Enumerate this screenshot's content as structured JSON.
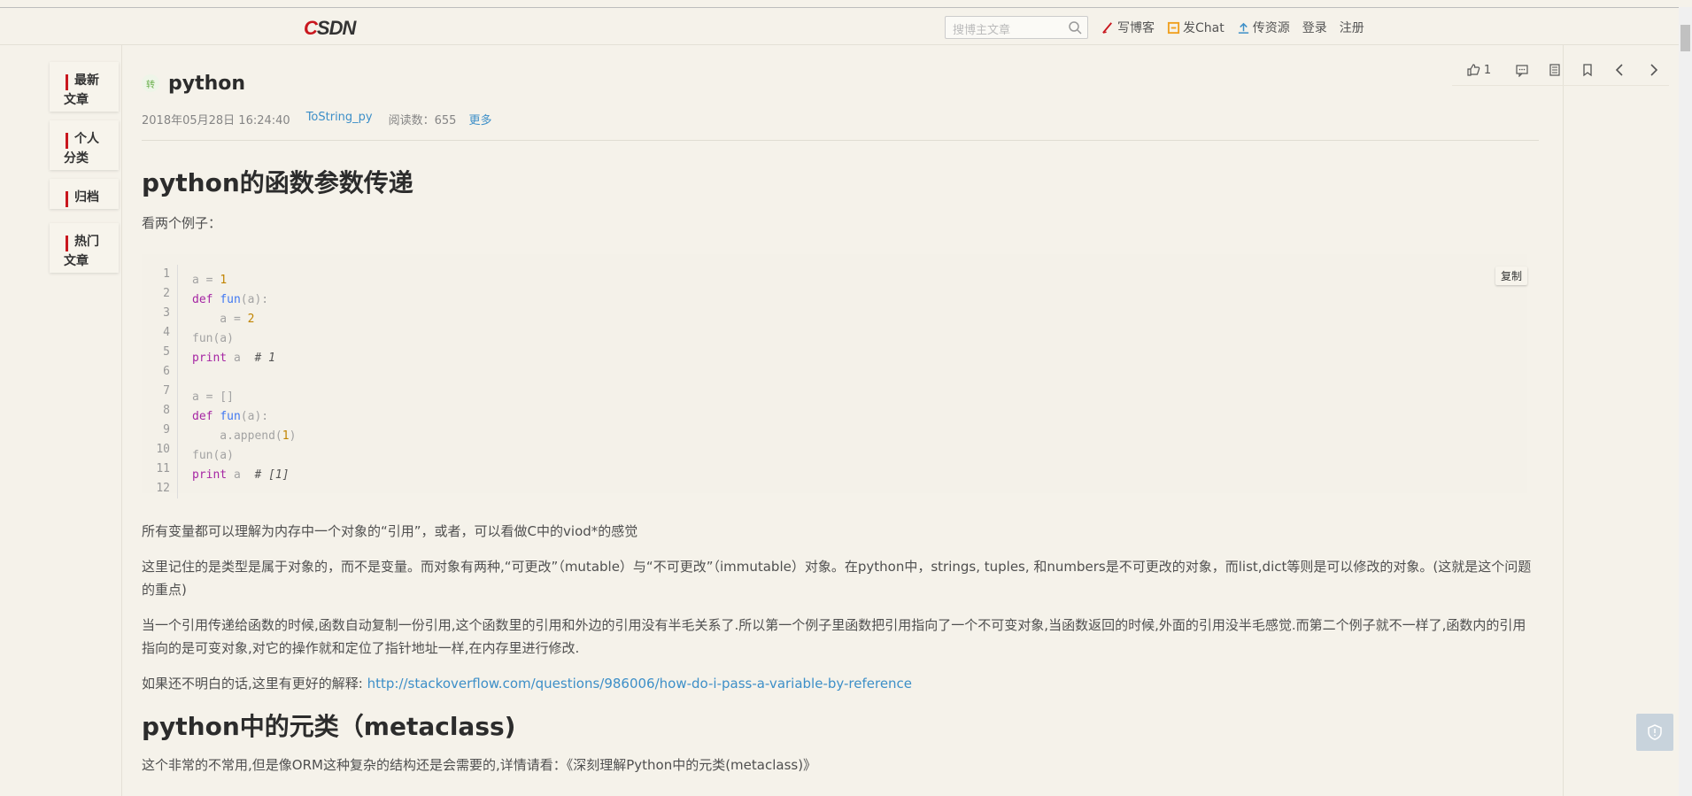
{
  "header": {
    "logo": "CSDN",
    "search_placeholder": "搜博主文章",
    "nav": [
      {
        "label": "写博客",
        "icon": "pen-icon"
      },
      {
        "label": "发Chat",
        "icon": "chat-icon"
      },
      {
        "label": "传资源",
        "icon": "upload-icon"
      },
      {
        "label": "登录"
      },
      {
        "label": "注册"
      }
    ]
  },
  "sidebar": {
    "items": [
      {
        "label": "最新文章"
      },
      {
        "label": "个人分类"
      },
      {
        "label": "归档"
      },
      {
        "label": "热门文章"
      }
    ]
  },
  "toolbar": {
    "like_count": "1",
    "icons": [
      "thumbs-up-icon",
      "comment-icon",
      "list-icon",
      "bookmark-icon",
      "prev-arrow-icon",
      "next-arrow-icon"
    ]
  },
  "article": {
    "type_badge": "转",
    "title": "python",
    "date": "2018年05月28日 16:24:40",
    "author": "ToString_py",
    "read_count": "阅读数：655",
    "more": "更多",
    "section1_heading": "python的函数参数传递",
    "intro": "看两个例子：",
    "copy_label": "复制",
    "line_numbers": [
      "1",
      "2",
      "3",
      "4",
      "5",
      "6",
      "7",
      "8",
      "9",
      "10",
      "11",
      "12"
    ],
    "paragraphs": [
      "所有变量都可以理解为内存中一个对象的“引用”，或者，可以看做C中的viod*的感觉",
      "这里记住的是类型是属于对象的，而不是变量。而对象有两种,“可更改”（mutable）与“不可更改”（immutable）对象。在python中，strings, tuples, 和numbers是不可更改的对象，而list,dict等则是可以修改的对象。(这就是这个问题的重点)",
      "当一个引用传递给函数的时候,函数自动复制一份引用,这个函数里的引用和外边的引用没有半毛关系了.所以第一个例子里函数把引用指向了一个不可变对象,当函数返回的时候,外面的引用没半毛感觉.而第二个例子就不一样了,函数内的引用指向的是可变对象,对它的操作就和定位了指针地址一样,在内存里进行修改."
    ],
    "link_prefix": "如果还不明白的话,这里有更好的解释: ",
    "link_url": "http://stackoverflow.com/questions/986006/how-do-i-pass-a-variable-by-reference",
    "section2_heading": "python中的元类（metaclass)",
    "section2_text": "这个非常的不常用,但是像ORM这种复杂的结构还是会需要的,详情请看：《深刻理解Python中的元类(metaclass)》"
  }
}
